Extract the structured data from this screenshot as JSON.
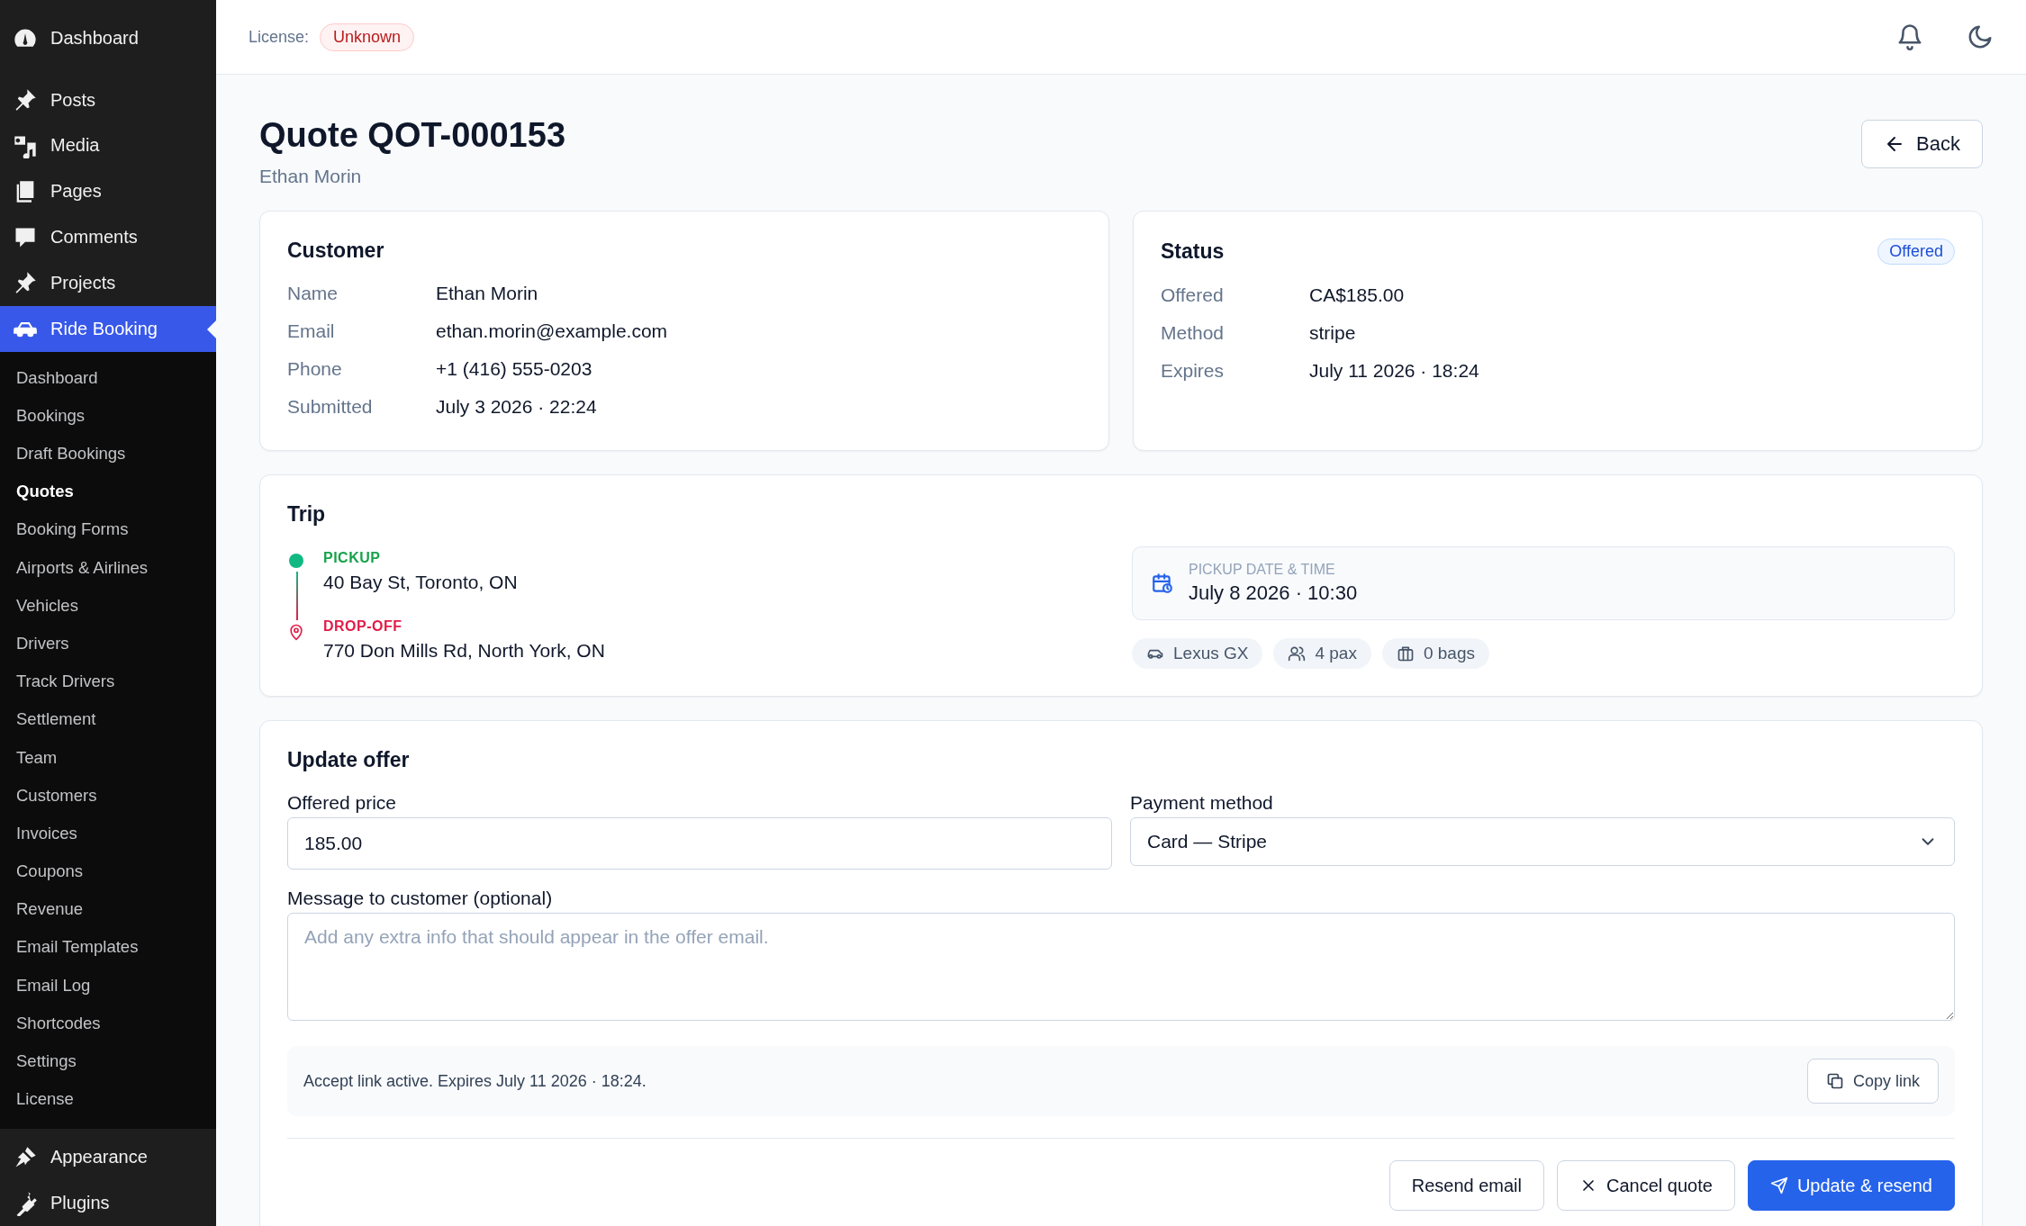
{
  "sidebar": {
    "items": [
      {
        "label": "Dashboard",
        "selected": false
      },
      {
        "label": "Posts",
        "selected": false
      },
      {
        "label": "Media",
        "selected": false
      },
      {
        "label": "Pages",
        "selected": false
      },
      {
        "label": "Comments",
        "selected": false
      },
      {
        "label": "Projects",
        "selected": false
      },
      {
        "label": "Ride Booking",
        "selected": true,
        "children": [
          {
            "label": "Dashboard",
            "selected": false
          },
          {
            "label": "Bookings",
            "selected": false
          },
          {
            "label": "Draft Bookings",
            "selected": false
          },
          {
            "label": "Quotes",
            "selected": true
          },
          {
            "label": "Booking Forms",
            "selected": false
          },
          {
            "label": "Airports & Airlines",
            "selected": false
          },
          {
            "label": "Vehicles",
            "selected": false
          },
          {
            "label": "Drivers",
            "selected": false
          },
          {
            "label": "Track Drivers",
            "selected": false
          },
          {
            "label": "Settlement",
            "selected": false
          },
          {
            "label": "Team",
            "selected": false
          },
          {
            "label": "Customers",
            "selected": false
          },
          {
            "label": "Invoices",
            "selected": false
          },
          {
            "label": "Coupons",
            "selected": false
          },
          {
            "label": "Revenue",
            "selected": false
          },
          {
            "label": "Email Templates",
            "selected": false
          },
          {
            "label": "Email Log",
            "selected": false
          },
          {
            "label": "Shortcodes",
            "selected": false
          },
          {
            "label": "Settings",
            "selected": false
          },
          {
            "label": "License",
            "selected": false
          }
        ]
      },
      {
        "label": "Appearance",
        "selected": false
      },
      {
        "label": "Plugins",
        "selected": false
      }
    ]
  },
  "header": {
    "license_label": "License:",
    "license_badge": "Unknown"
  },
  "page": {
    "title": "Quote QOT-000153",
    "subtitle": "Ethan Morin",
    "back_button": "Back"
  },
  "customer": {
    "title": "Customer",
    "fields": [
      {
        "label": "Name",
        "value": "Ethan Morin"
      },
      {
        "label": "Email",
        "value": "ethan.morin@example.com"
      },
      {
        "label": "Phone",
        "value": "+1 (416) 555-0203"
      },
      {
        "label": "Submitted",
        "value": "July 3 2026 · 22:24"
      }
    ]
  },
  "status": {
    "title": "Status",
    "badge": "Offered",
    "fields": [
      {
        "label": "Offered",
        "value": "CA$185.00"
      },
      {
        "label": "Method",
        "value": "stripe"
      },
      {
        "label": "Expires",
        "value": "July 11 2026 · 18:24"
      }
    ]
  },
  "trip": {
    "title": "Trip",
    "stops": [
      {
        "kind": "pickup",
        "label": "PICKUP",
        "address": "40 Bay St, Toronto, ON"
      },
      {
        "kind": "dropoff",
        "label": "DROP-OFF",
        "address": "770 Don Mills Rd, North York, ON"
      }
    ],
    "pickup_time": {
      "label": "PICKUP DATE & TIME",
      "value": "July 8 2026 · 10:30"
    },
    "chips": [
      {
        "kind": "vehicle",
        "text": "Lexus GX"
      },
      {
        "kind": "passengers",
        "text": "4 pax"
      },
      {
        "kind": "bags",
        "text": "0 bags"
      }
    ]
  },
  "update_offer": {
    "title": "Update offer",
    "price": {
      "label": "Offered price",
      "value": "185.00"
    },
    "payment": {
      "label": "Payment method",
      "value": "Card — Stripe"
    },
    "message": {
      "label": "Message to customer (optional)",
      "placeholder": "Add any extra info that should appear in the offer email."
    },
    "link_notice": {
      "text": "Accept link active. Expires July 11 2026 · 18:24.",
      "button": "Copy link"
    },
    "actions": [
      {
        "kind": "plain",
        "label": "Resend email"
      },
      {
        "kind": "cancel",
        "label": "Cancel quote"
      },
      {
        "kind": "primary",
        "label": "Update & resend"
      }
    ]
  }
}
